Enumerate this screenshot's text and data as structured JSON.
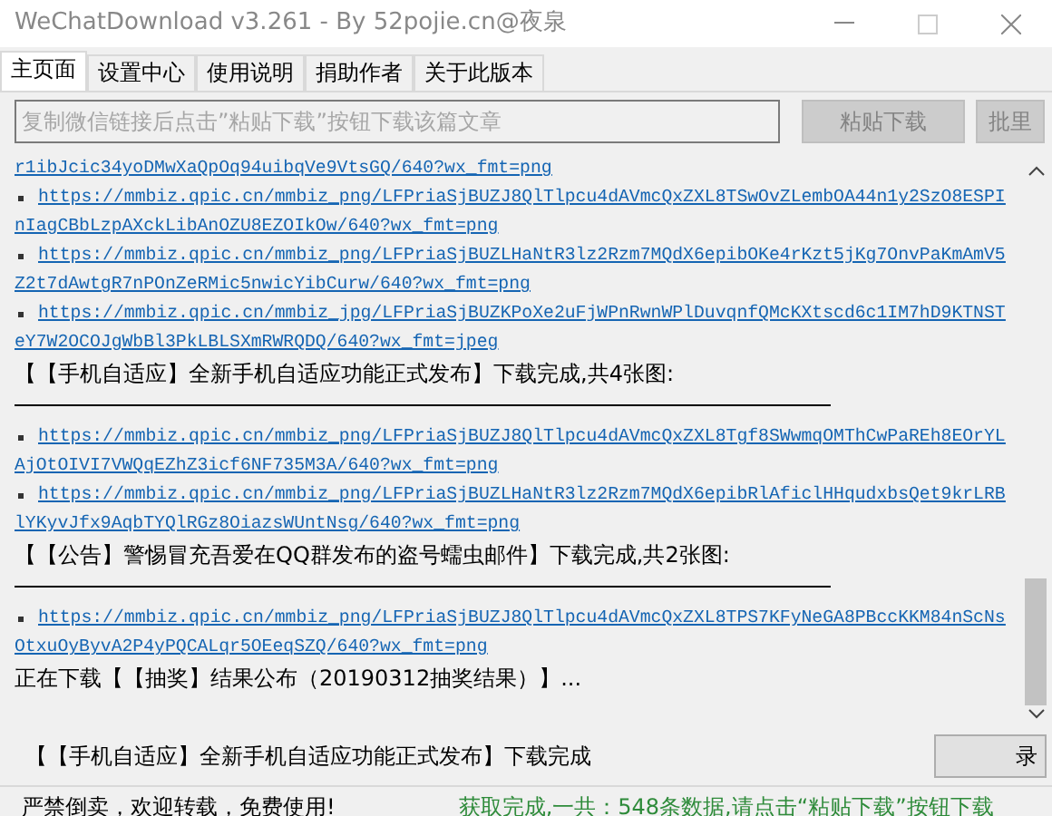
{
  "window": {
    "title": "WeChatDownload v3.261 - By 52pojie.cn@夜泉"
  },
  "tabs": [
    {
      "label": "主页面",
      "selected": true
    },
    {
      "label": "设置中心",
      "selected": false
    },
    {
      "label": "使用说明",
      "selected": false
    },
    {
      "label": "捐助作者",
      "selected": false
    },
    {
      "label": "关于此版本",
      "selected": false
    }
  ],
  "url_field": {
    "placeholder": "复制微信链接后点击”粘贴下载”按钮下载该篇文章"
  },
  "buttons": [
    {
      "label": "粘贴下载",
      "disabled": true
    },
    {
      "label": "批里",
      "disabled": true
    }
  ],
  "log": [
    {
      "kind": "link",
      "bullet": false,
      "text": "r1ibJcic34yoDMwXaQpOq94uibqVe9VtsGQ/640?wx_fmt=png"
    },
    {
      "kind": "link",
      "bullet": true,
      "text": "https://mmbiz.qpic.cn/mmbiz_png/LFPriaSjBUZJ8QlTlpcu4dAVmcQxZXL8TSwOvZLembOA44n1y2SzO8ESPInIagCBbLzpAXckLibAnOZU8EZOIkOw/640?wx_fmt=png"
    },
    {
      "kind": "link",
      "bullet": true,
      "text": "https://mmbiz.qpic.cn/mmbiz_png/LFPriaSjBUZLHaNtR3lz2Rzm7MQdX6epibOKe4rKzt5jKg7OnvPaKmAmV5Z2t7dAwtgR7nPOnZeRMic5nwicYibCurw/640?wx_fmt=png"
    },
    {
      "kind": "link",
      "bullet": true,
      "text": "https://mmbiz.qpic.cn/mmbiz_jpg/LFPriaSjBUZKPoXe2uFjWPnRwnWPlDuvqnfQMcKXtscd6c1IM7hD9KTNSTeY7W2OCOJgWbBl3PkLBLSXmRWRQDQ/640?wx_fmt=jpeg"
    },
    {
      "kind": "heading",
      "text": "【【手机自适应】全新手机自适应功能正式发布】下载完成,共4张图:"
    },
    {
      "kind": "rule"
    },
    {
      "kind": "link",
      "bullet": true,
      "text": "https://mmbiz.qpic.cn/mmbiz_png/LFPriaSjBUZJ8QlTlpcu4dAVmcQxZXL8Tgf8SWwmqOMThCwPaREh8EOrYLAjOtOIVI7VWQqEZhZ3icf6NF735M3A/640?wx_fmt=png"
    },
    {
      "kind": "link",
      "bullet": true,
      "text": "https://mmbiz.qpic.cn/mmbiz_png/LFPriaSjBUZLHaNtR3lz2Rzm7MQdX6epibRlAficlHHqudxbsQet9krLRBlYKyvJfx9AqbTYQlRGz8OiazsWUntNsg/640?wx_fmt=png"
    },
    {
      "kind": "heading",
      "text": "【【公告】警惕冒充吾爱在QQ群发布的盗号蠕虫邮件】下载完成,共2张图:"
    },
    {
      "kind": "rule"
    },
    {
      "kind": "link",
      "bullet": true,
      "text": "https://mmbiz.qpic.cn/mmbiz_png/LFPriaSjBUZJ8QlTlpcu4dAVmcQxZXL8TPS7KFyNeGA8PBccKKM84nScNsOtxuOyByvA2P4yPQCALqr5OEeqSZQ/640?wx_fmt=png"
    },
    {
      "kind": "heading",
      "text": "正在下载【【抽奖】结果公布（20190312抽奖结果）】..."
    }
  ],
  "current": {
    "text": "【【手机自适应】全新手机自适应功能正式发布】下载完成",
    "button": "录"
  },
  "status_bar": {
    "left": "严禁倒卖，欢迎转载，免费使用!",
    "right": "获取完成,一共：548条数据,请点击“粘贴下载”按钮下载"
  }
}
